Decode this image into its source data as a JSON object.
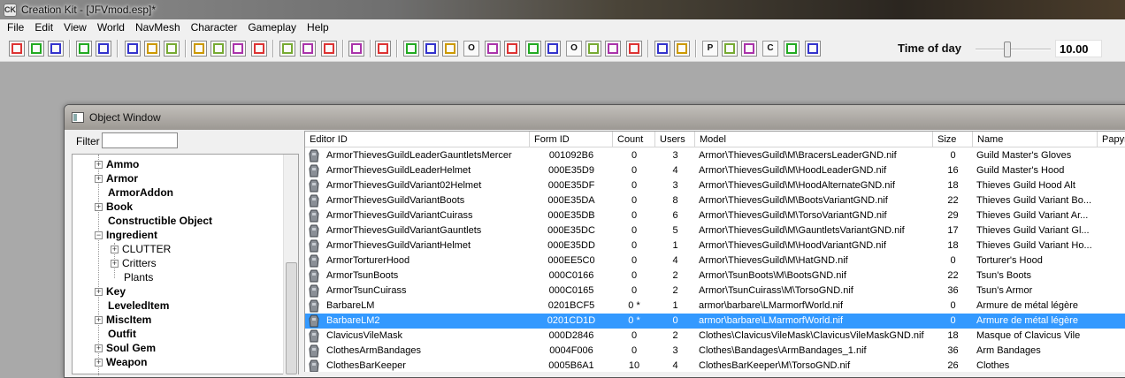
{
  "window": {
    "app": "Creation Kit",
    "title": "Creation Kit - [JFVmod.esp]*"
  },
  "menus": [
    "File",
    "Edit",
    "View",
    "World",
    "NavMesh",
    "Character",
    "Gameplay",
    "Help"
  ],
  "toolbar": {
    "labeled_buttons": [
      "O",
      "P",
      "C",
      "W"
    ],
    "time_of_day_label": "Time of day",
    "time_of_day_value": "10.00",
    "time_of_day_fraction": 0.42
  },
  "object_window": {
    "title": "Object Window",
    "filter_label": "Filter",
    "filter_value": "",
    "tree": [
      {
        "label": "Ammo",
        "bold": true,
        "expander": "+",
        "level": 0
      },
      {
        "label": "Armor",
        "bold": true,
        "expander": "+",
        "level": 0
      },
      {
        "label": "ArmorAddon",
        "bold": true,
        "expander": "",
        "level": 0
      },
      {
        "label": "Book",
        "bold": true,
        "expander": "+",
        "level": 0
      },
      {
        "label": "Constructible Object",
        "bold": true,
        "expander": "",
        "level": 0
      },
      {
        "label": "Ingredient",
        "bold": true,
        "expander": "−",
        "level": 0
      },
      {
        "label": "CLUTTER",
        "bold": false,
        "expander": "+",
        "level": 1
      },
      {
        "label": "Critters",
        "bold": false,
        "expander": "+",
        "level": 1
      },
      {
        "label": "Plants",
        "bold": false,
        "expander": "",
        "level": 1
      },
      {
        "label": "Key",
        "bold": true,
        "expander": "+",
        "level": 0
      },
      {
        "label": "LeveledItem",
        "bold": true,
        "expander": "",
        "level": 0
      },
      {
        "label": "MiscItem",
        "bold": true,
        "expander": "+",
        "level": 0
      },
      {
        "label": "Outfit",
        "bold": true,
        "expander": "",
        "level": 0
      },
      {
        "label": "Soul Gem",
        "bold": true,
        "expander": "+",
        "level": 0
      },
      {
        "label": "Weapon",
        "bold": true,
        "expander": "+",
        "level": 0
      }
    ],
    "columns": [
      "Editor ID",
      "Form ID",
      "Count",
      "Users",
      "Model",
      "Size",
      "Name",
      "Papyr"
    ],
    "rows": [
      {
        "id": "ArmorThievesGuildLeaderGauntletsMercer",
        "form": "001092B6",
        "count": "0",
        "users": "3",
        "model": "Armor\\ThievesGuild\\M\\BracersLeaderGND.nif",
        "size": "0",
        "name": "Guild Master's Gloves"
      },
      {
        "id": "ArmorThievesGuildLeaderHelmet",
        "form": "000E35D9",
        "count": "0",
        "users": "4",
        "model": "Armor\\ThievesGuild\\M\\HoodLeaderGND.nif",
        "size": "16",
        "name": "Guild Master's Hood"
      },
      {
        "id": "ArmorThievesGuildVariant02Helmet",
        "form": "000E35DF",
        "count": "0",
        "users": "3",
        "model": "Armor\\ThievesGuild\\M\\HoodAlternateGND.nif",
        "size": "18",
        "name": "Thieves Guild Hood Alt"
      },
      {
        "id": "ArmorThievesGuildVariantBoots",
        "form": "000E35DA",
        "count": "0",
        "users": "8",
        "model": "Armor\\ThievesGuild\\M\\BootsVariantGND.nif",
        "size": "22",
        "name": "Thieves Guild Variant Bo..."
      },
      {
        "id": "ArmorThievesGuildVariantCuirass",
        "form": "000E35DB",
        "count": "0",
        "users": "6",
        "model": "Armor\\ThievesGuild\\M\\TorsoVariantGND.nif",
        "size": "29",
        "name": "Thieves Guild Variant Ar..."
      },
      {
        "id": "ArmorThievesGuildVariantGauntlets",
        "form": "000E35DC",
        "count": "0",
        "users": "5",
        "model": "Armor\\ThievesGuild\\M\\GauntletsVariantGND.nif",
        "size": "17",
        "name": "Thieves Guild Variant Gl..."
      },
      {
        "id": "ArmorThievesGuildVariantHelmet",
        "form": "000E35DD",
        "count": "0",
        "users": "1",
        "model": "Armor\\ThievesGuild\\M\\HoodVariantGND.nif",
        "size": "18",
        "name": "Thieves Guild Variant Ho..."
      },
      {
        "id": "ArmorTorturerHood",
        "form": "000EE5C0",
        "count": "0",
        "users": "4",
        "model": "Armor\\ThievesGuild\\M\\HatGND.nif",
        "size": "0",
        "name": "Torturer's Hood"
      },
      {
        "id": "ArmorTsunBoots",
        "form": "000C0166",
        "count": "0",
        "users": "2",
        "model": "Armor\\TsunBoots\\M\\BootsGND.nif",
        "size": "22",
        "name": "Tsun's Boots"
      },
      {
        "id": "ArmorTsunCuirass",
        "form": "000C0165",
        "count": "0",
        "users": "2",
        "model": "Armor\\TsunCuirass\\M\\TorsoGND.nif",
        "size": "36",
        "name": "Tsun's Armor"
      },
      {
        "id": "BarbareLM",
        "form": "0201BCF5",
        "count": "0 *",
        "users": "1",
        "model": "armor\\barbare\\LMarmorfWorld.nif",
        "size": "0",
        "name": "Armure de métal légère"
      },
      {
        "id": "BarbareLM2",
        "form": "0201CD1D",
        "count": "0 *",
        "users": "0",
        "model": "armor\\barbare\\LMarmorfWorld.nif",
        "size": "0",
        "name": "Armure de métal légère",
        "selected": true
      },
      {
        "id": "ClavicusVileMask",
        "form": "000D2846",
        "count": "0",
        "users": "2",
        "model": "Clothes\\ClavicusVileMask\\ClavicusVileMaskGND.nif",
        "size": "18",
        "name": "Masque of Clavicus Vile"
      },
      {
        "id": "ClothesArmBandages",
        "form": "0004F006",
        "count": "0",
        "users": "3",
        "model": "Clothes\\Bandages\\ArmBandages_1.nif",
        "size": "36",
        "name": "Arm Bandages"
      },
      {
        "id": "ClothesBarKeeper",
        "form": "0005B6A1",
        "count": "10",
        "users": "4",
        "model": "ClothesBarKeeper\\M\\TorsoGND.nif",
        "size": "26",
        "name": "Clothes"
      }
    ]
  }
}
